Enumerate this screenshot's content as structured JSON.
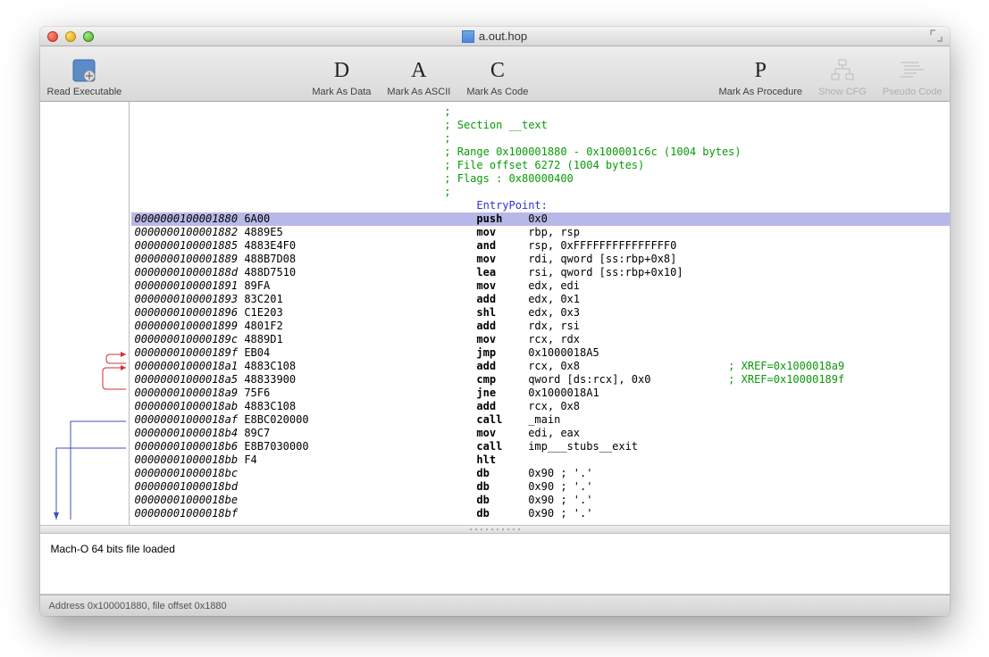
{
  "window": {
    "title": "a.out.hop"
  },
  "toolbar": {
    "read_executable": "Read Executable",
    "mark_data": "Mark As Data",
    "mark_ascii": "Mark As ASCII",
    "mark_code": "Mark As Code",
    "mark_procedure": "Mark As Procedure",
    "show_cfg": "Show CFG",
    "pseudo_code": "Pseudo Code"
  },
  "letters": {
    "D": "D",
    "A": "A",
    "C": "C",
    "P": "P"
  },
  "section": {
    "header1": "; ",
    "header2": "; Section __text",
    "header3": "; ",
    "header4": "; Range 0x100001880 - 0x100001c6c (1004 bytes)",
    "header5": "; File offset 6272 (1004 bytes)",
    "header6": "; Flags : 0x80000400",
    "header7": ";",
    "entry": "     EntryPoint:"
  },
  "rows": [
    {
      "addr": "0000000100001880",
      "bytes": "6A00",
      "mn": "push",
      "ops": "0x0",
      "hl": true
    },
    {
      "addr": "0000000100001882",
      "bytes": "4889E5",
      "mn": "mov",
      "ops": "rbp, rsp"
    },
    {
      "addr": "0000000100001885",
      "bytes": "4883E4F0",
      "mn": "and",
      "ops": "rsp, 0xFFFFFFFFFFFFFFF0"
    },
    {
      "addr": "0000000100001889",
      "bytes": "488B7D08",
      "mn": "mov",
      "ops": "rdi, qword [ss:rbp+0x8]"
    },
    {
      "addr": "000000010000188d",
      "bytes": "488D7510",
      "mn": "lea",
      "ops": "rsi, qword [ss:rbp+0x10]"
    },
    {
      "addr": "0000000100001891",
      "bytes": "89FA",
      "mn": "mov",
      "ops": "edx, edi"
    },
    {
      "addr": "0000000100001893",
      "bytes": "83C201",
      "mn": "add",
      "ops": "edx, 0x1"
    },
    {
      "addr": "0000000100001896",
      "bytes": "C1E203",
      "mn": "shl",
      "ops": "edx, 0x3"
    },
    {
      "addr": "0000000100001899",
      "bytes": "4801F2",
      "mn": "add",
      "ops": "rdx, rsi"
    },
    {
      "addr": "000000010000189c",
      "bytes": "4889D1",
      "mn": "mov",
      "ops": "rcx, rdx"
    },
    {
      "addr": "000000010000189f",
      "bytes": "EB04",
      "mn": "jmp",
      "ops": "0x1000018A5"
    },
    {
      "addr": "00000001000018a1",
      "bytes": "4883C108",
      "mn": "add",
      "ops": "rcx, 0x8",
      "xref": "; XREF=0x1000018a9"
    },
    {
      "addr": "00000001000018a5",
      "bytes": "48833900",
      "mn": "cmp",
      "ops": "qword [ds:rcx], 0x0",
      "xref": "; XREF=0x10000189f"
    },
    {
      "addr": "00000001000018a9",
      "bytes": "75F6",
      "mn": "jne",
      "ops": "0x1000018A1"
    },
    {
      "addr": "00000001000018ab",
      "bytes": "4883C108",
      "mn": "add",
      "ops": "rcx, 0x8"
    },
    {
      "addr": "00000001000018af",
      "bytes": "E8BC020000",
      "mn": "call",
      "ops": "_main"
    },
    {
      "addr": "00000001000018b4",
      "bytes": "89C7",
      "mn": "mov",
      "ops": "edi, eax"
    },
    {
      "addr": "00000001000018b6",
      "bytes": "E8B7030000",
      "mn": "call",
      "ops": "imp___stubs__exit"
    },
    {
      "addr": "00000001000018bb",
      "bytes": "F4",
      "mn": "hlt",
      "ops": ""
    },
    {
      "addr": "00000001000018bc",
      "bytes": "",
      "mn": "db",
      "ops": "0x90 ; '.'"
    },
    {
      "addr": "00000001000018bd",
      "bytes": "",
      "mn": "db",
      "ops": "0x90 ; '.'"
    },
    {
      "addr": "00000001000018be",
      "bytes": "",
      "mn": "db",
      "ops": "0x90 ; '.'"
    },
    {
      "addr": "00000001000018bf",
      "bytes": "",
      "mn": "db",
      "ops": "0x90 ; '.'"
    }
  ],
  "log": {
    "message": "Mach-O 64 bits file loaded"
  },
  "status": {
    "text": "Address 0x100001880, file offset 0x1880"
  }
}
